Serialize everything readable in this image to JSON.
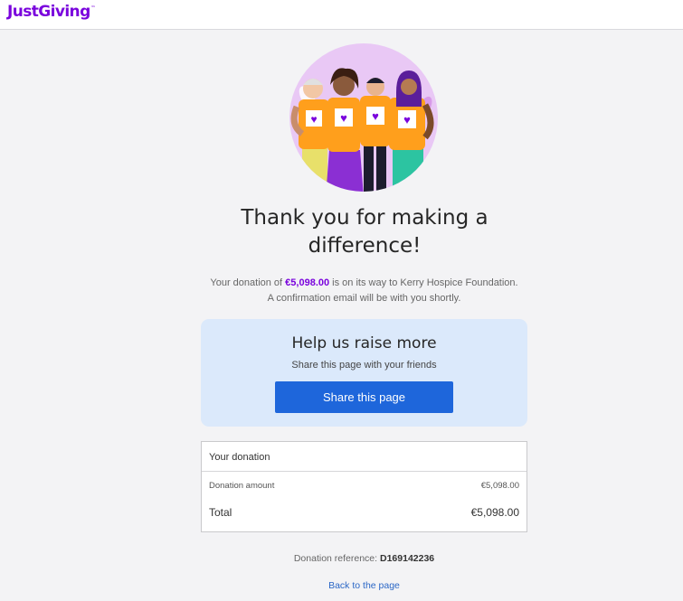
{
  "header": {
    "logo_text": "JustGiving",
    "logo_mark": "™"
  },
  "hero": {
    "illustration": "four-people-embracing-heart-shirts",
    "circle_color": "#e9c8f5"
  },
  "thanks": {
    "title_line1": "Thank you for making a",
    "title_line2": "difference!",
    "message_prefix": "Your donation of",
    "amount": "€5,098.00",
    "message_suffix": "is on its way to Kerry Hospice Foundation.",
    "confirmation": "A confirmation email will be with you shortly."
  },
  "share": {
    "title": "Help us raise more",
    "subtitle": "Share this page with your friends",
    "button_label": "Share this page",
    "card_color": "#dbe9fb",
    "button_color": "#1e66db"
  },
  "donation": {
    "heading": "Your donation",
    "amount_label": "Donation amount",
    "amount_value": "€5,098.00",
    "total_label": "Total",
    "total_value": "€5,098.00"
  },
  "footer": {
    "reference_label": "Donation reference:",
    "reference_value": "D169142236",
    "back_link": "Back to the page"
  },
  "colors": {
    "brand": "#7a04dd",
    "link": "#2b67c6",
    "background": "#f3f3f5"
  }
}
